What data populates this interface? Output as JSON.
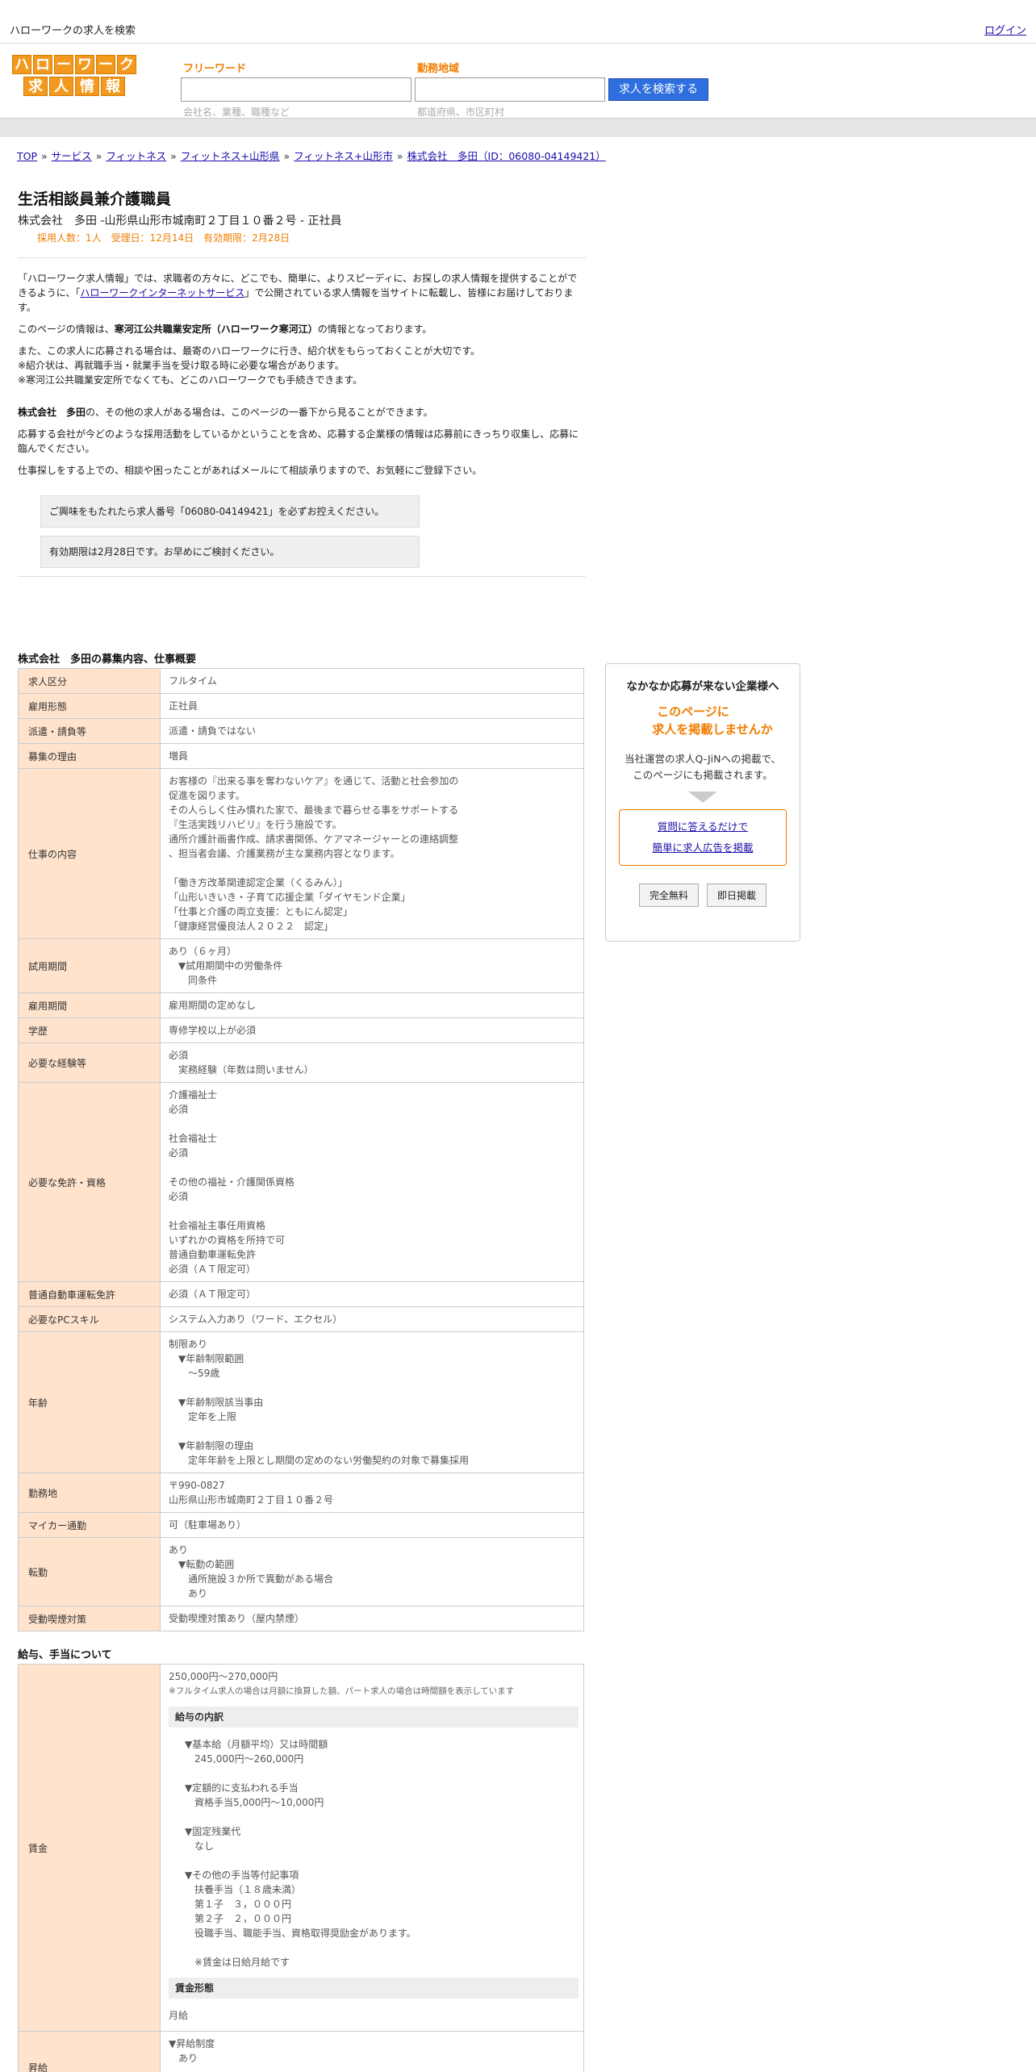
{
  "topbar": {
    "tagline": "ハローワークの求人を検索",
    "login": "ログイン"
  },
  "logo": {
    "row1": [
      "ハ",
      "ロ",
      "ー",
      "ワ",
      "ー",
      "ク"
    ],
    "row2": [
      "求",
      "人",
      "情",
      "報"
    ]
  },
  "search": {
    "freeword_label": "フリーワード",
    "freeword_hint": "会社名、業種、職種など",
    "area_label": "勤務地域",
    "area_hint": "都道府県、市区町村",
    "button": "求人を検索する"
  },
  "breadcrumb": [
    "TOP",
    "サービス",
    "フィットネス",
    "フィットネス+山形県",
    "フィットネス+山形市",
    "株式会社　多田（ID：06080-04149421）"
  ],
  "breadcrumb_sep": "»",
  "job": {
    "title": "生活相談員兼介護職員",
    "subline": "株式会社　多田 -山形県山形市城南町２丁目１０番２号 - 正社員",
    "meta": "採用人数：1人　受理日：12月14日　有効期限：2月28日"
  },
  "intro": {
    "p1_pre": "「ハローワーク求人情報」では、求職者の方々に、どこでも、簡単に、よりスピーディに、お探しの求人情報を提供することができるように、「",
    "p1_link": "ハローワークインターネットサービス",
    "p1_post": "」で公開されている求人情報を当サイトに転載し、皆様にお届けしております。",
    "p2_pre": "このページの情報は、",
    "p2_bold": "寒河江公共職業安定所（ハローワーク寒河江）",
    "p2_post": "の情報となっております。",
    "p3": "また、この求人に応募される場合は、最寄のハローワークに行き、紹介状をもらっておくことが大切です。\n※紹介状は、再就職手当・就業手当を受け取る時に必要な場合があります。\n※寒河江公共職業安定所でなくても、どこのハローワークでも手続きできます。",
    "p4_bold": "株式会社　多田",
    "p4_post": "の、その他の求人がある場合は、このページの一番下から見ることができます。",
    "p5": "応募する会社が今どのような採用活動をしているかということを含め、応募する企業様の情報は応募前にきっちり収集し、応募に臨んでください。",
    "p6": "仕事探しをする上での、相談や困ったことがあればメールにて相談承りますので、お気軽にご登録下さい。",
    "notice1": "ご興味をもたれたら求人番号「06080-04149421」を必ずお控えください。",
    "notice2": "有効期限は2月28日です。お早めにご検討ください。"
  },
  "overview": {
    "heading": "株式会社　多田の募集内容、仕事概要",
    "rows": [
      {
        "label": "求人区分",
        "value": "フルタイム"
      },
      {
        "label": "雇用形態",
        "value": "正社員"
      },
      {
        "label": "派遣・請負等",
        "value": "派遣・請負ではない"
      },
      {
        "label": "募集の理由",
        "value": "増員"
      },
      {
        "label": "仕事の内容",
        "value": "お客様の『出来る事を奪わないケア』を通じて、活動と社会参加の\n促進を図ります。\nその人らしく住み慣れた家で、最後まで暮らせる事をサポートする\n『生活実践リハビリ』を行う施設です。\n通所介護計画書作成、請求書関係、ケアマネージャーとの連絡調整\n、担当者会議、介護業務が主な業務内容となります。\n\n「働き方改革関連認定企業（くるみん）」\n「山形いきいき・子育て応援企業「ダイヤモンド企業」\n「仕事と介護の両立支援：ともにん認定」\n「健康経営優良法人２０２２　認定」"
      },
      {
        "label": "試用期間",
        "value": "あり（６ヶ月）\n　▼試用期間中の労働条件\n　　同条件"
      },
      {
        "label": "雇用期間",
        "value": "雇用期間の定めなし"
      },
      {
        "label": "学歴",
        "value": "専修学校以上が必須"
      },
      {
        "label": "必要な経験等",
        "value": "必須\n　実務経験（年数は問いません）"
      },
      {
        "label": "必要な免許・資格",
        "value": "介護福祉士\n必須\n\n社会福祉士\n必須\n\nその他の福祉・介護関係資格\n必須\n\n社会福祉主事任用資格\nいずれかの資格を所持で可\n普通自動車運転免許\n必須（ＡＴ限定可）\n"
      },
      {
        "label": "普通自動車運転免許",
        "value": "必須（ＡＴ限定可）"
      },
      {
        "label": "必要なPCスキル",
        "value": "システム入力あり（ワード、エクセル）"
      },
      {
        "label": "年齢",
        "value": "制限あり\n　▼年齢制限範囲\n　　〜59歳\n\n　▼年齢制限該当事由\n　　定年を上限\n\n　▼年齢制限の理由\n　　定年年齢を上限とし期間の定めのない労働契約の対象で募集採用"
      },
      {
        "label": "勤務地",
        "value": "〒990-0827\n山形県山形市城南町２丁目１０番２号"
      },
      {
        "label": "マイカー通勤",
        "value": "可（駐車場あり）"
      },
      {
        "label": "転勤",
        "value": "あり\n　▼転勤の範囲\n　　通所施設３か所で異動がある場合\n　　あり"
      },
      {
        "label": "受動喫煙対策",
        "value": "受動喫煙対策あり（屋内禁煙）"
      }
    ]
  },
  "salary": {
    "heading": "給与、手当について",
    "wage_label": "賃金",
    "wage_range": "250,000円〜270,000円",
    "wage_note": "※フルタイム求人の場合は月額に換算した額、パート求人の場合は時間額を表示しています",
    "breakdown_head": "給与の内訳",
    "breakdown": "　▼基本給（月額平均）又は時間額\n　　245,000円〜260,000円\n\n　▼定額的に支払われる手当\n　　資格手当5,000円〜10,000円\n\n　▼固定残業代\n　　なし\n\n　▼その他の手当等付記事項\n　　扶養手当（１８歳未満）\n　　第１子　３，０００円\n　　第２子　２，０００円\n　　役職手当、職能手当、資格取得奨励金があります。\n\n　　※賃金は日給月給です",
    "form_head": "賃金形態",
    "form_value": "月給",
    "raise_label": "昇給",
    "raise_value": "▼昇給制度\n　あり\n\n▼昇給（前年度実績）"
  },
  "ad": {
    "title": "なかなか応募が来ない企業様へ",
    "catch1": "このページに",
    "catch2": "求人を掲載しませんか",
    "desc": "当社運営の求人Q-JiNへの掲載で、\nこのページにも掲載されます。",
    "link1": "質問に答えるだけで",
    "link2": "簡単に求人広告を掲載",
    "btn1": "完全無料",
    "btn2": "即日掲載"
  }
}
